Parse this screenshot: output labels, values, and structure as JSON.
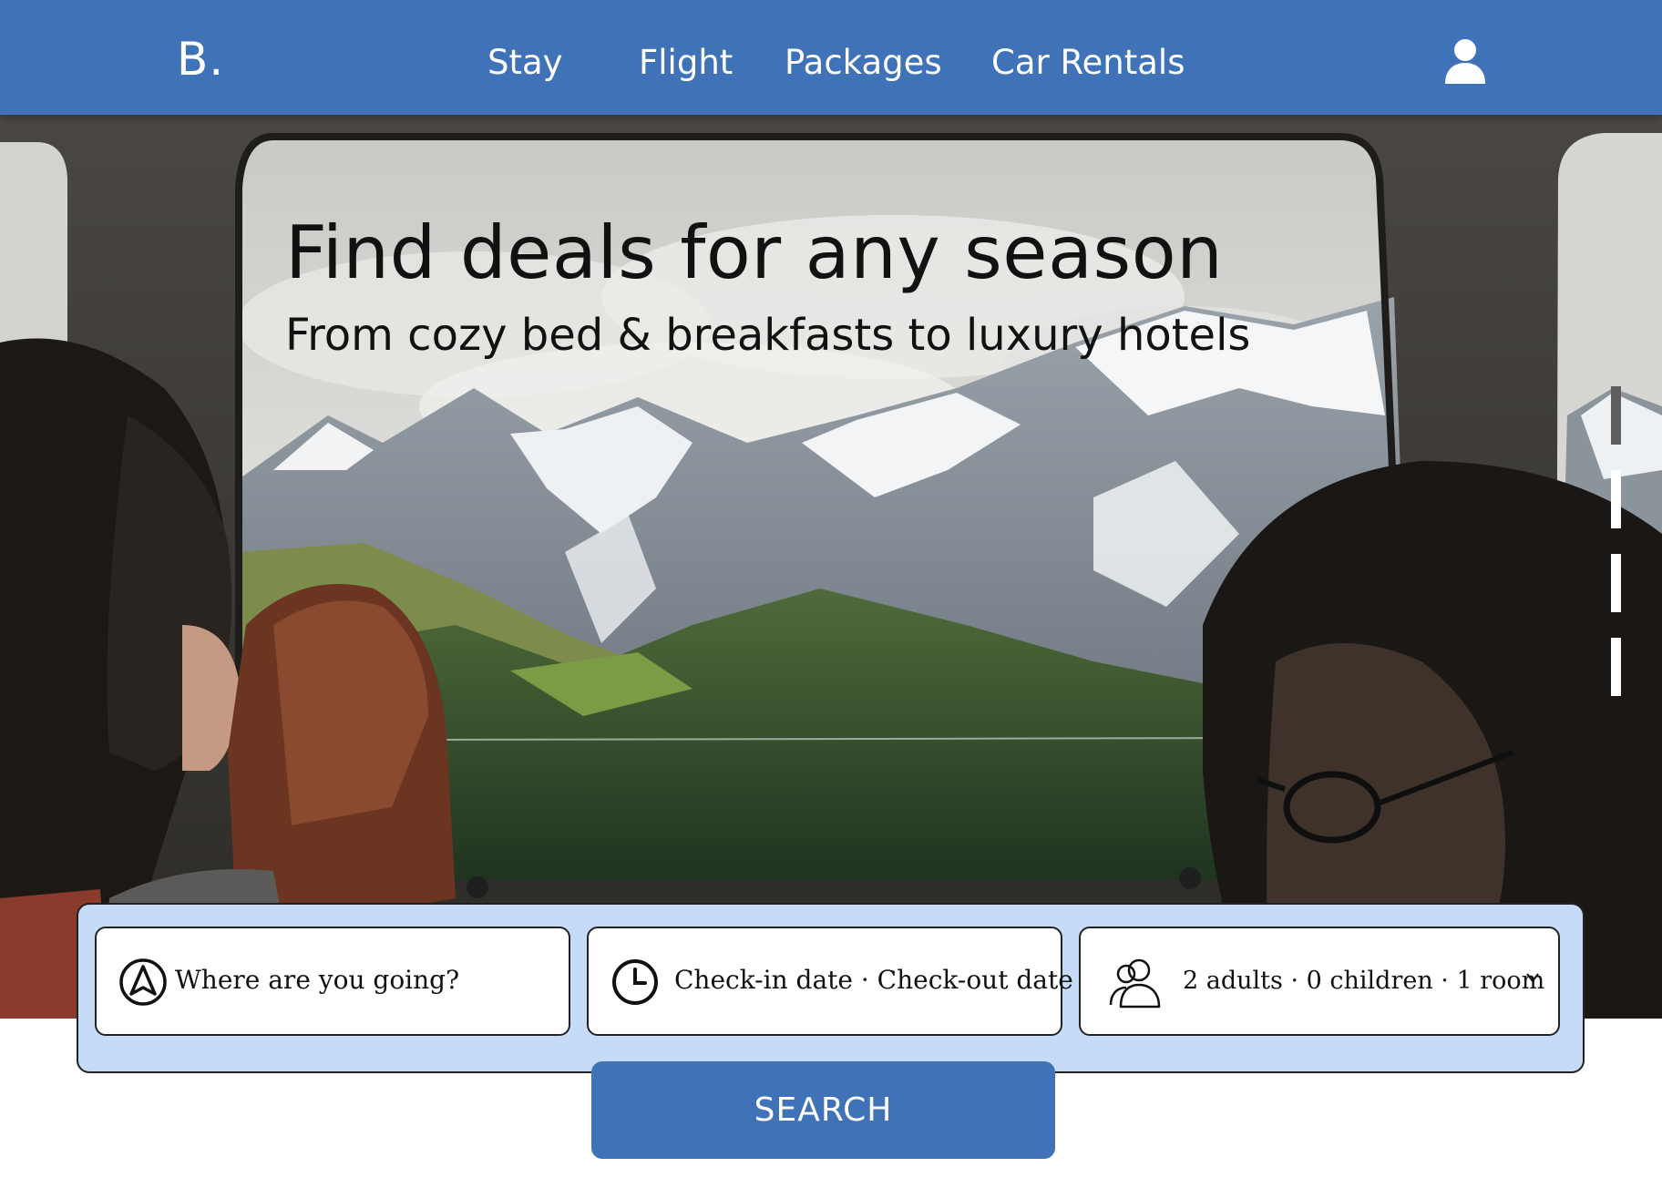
{
  "header": {
    "logo": "B.",
    "nav": {
      "stay": "Stay",
      "flight": "Flight",
      "packages": "Packages",
      "car_rentals": "Car Rentals"
    },
    "user_icon": "user-icon"
  },
  "hero": {
    "title": "Find deals for any season",
    "subtitle": "From cozy bed & breakfasts to luxury hotels",
    "image": "train-window-mountain-view",
    "slide_count": 4,
    "active_slide": 1
  },
  "search": {
    "destination": {
      "icon": "navigation-arrow-icon",
      "placeholder": "Where are you going?"
    },
    "dates": {
      "icon": "clock-icon",
      "text": "Check-in date · Check-out date"
    },
    "guests": {
      "icon": "people-icon",
      "text": "2 adults · 0 children · 1 room",
      "chevron": "v"
    },
    "button_label": "SEARCH"
  },
  "colors": {
    "primary": "#3f72b6",
    "panel": "#c6dbf8",
    "text": "#111111"
  }
}
